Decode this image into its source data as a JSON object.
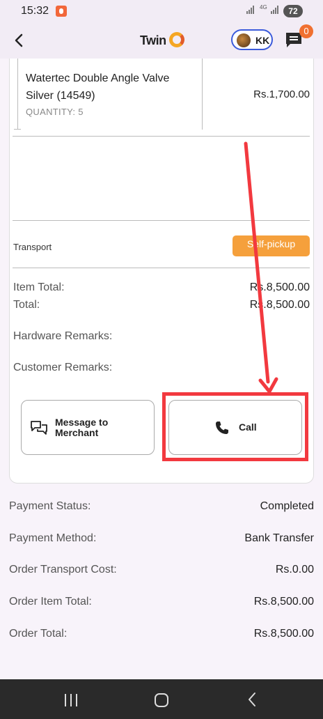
{
  "status_bar": {
    "time": "15:32",
    "network": "4G",
    "battery": "72"
  },
  "header": {
    "logo": "TwinC",
    "user_initials": "KK",
    "notification_count": "0"
  },
  "order_item": {
    "name": "Watertec Double Angle Valve Silver (14549)",
    "quantity": "QUANTITY: 5",
    "price": "Rs.1,700.00"
  },
  "transport": {
    "label": "Transport",
    "mode": "Self-pickup"
  },
  "totals": {
    "item_total_label": "Item Total:",
    "item_total_value": "Rs.8,500.00",
    "total_label": "Total:",
    "total_value": "Rs.8,500.00"
  },
  "remarks": {
    "hardware_label": "Hardware Remarks:",
    "customer_label": "Customer Remarks:"
  },
  "actions": {
    "message_label": "Message to Merchant",
    "call_label": "Call"
  },
  "summary": [
    {
      "label": "Payment Status:",
      "value": "Completed"
    },
    {
      "label": "Payment Method:",
      "value": "Bank Transfer"
    },
    {
      "label": "Order Transport Cost:",
      "value": "Rs.0.00"
    },
    {
      "label": "Order Item Total:",
      "value": "Rs.8,500.00"
    },
    {
      "label": "Order Total:",
      "value": "Rs.8,500.00"
    }
  ],
  "colors": {
    "accent": "#f5a03c",
    "annotation": "#f2393f",
    "brand_blue": "#3b5bdb"
  }
}
